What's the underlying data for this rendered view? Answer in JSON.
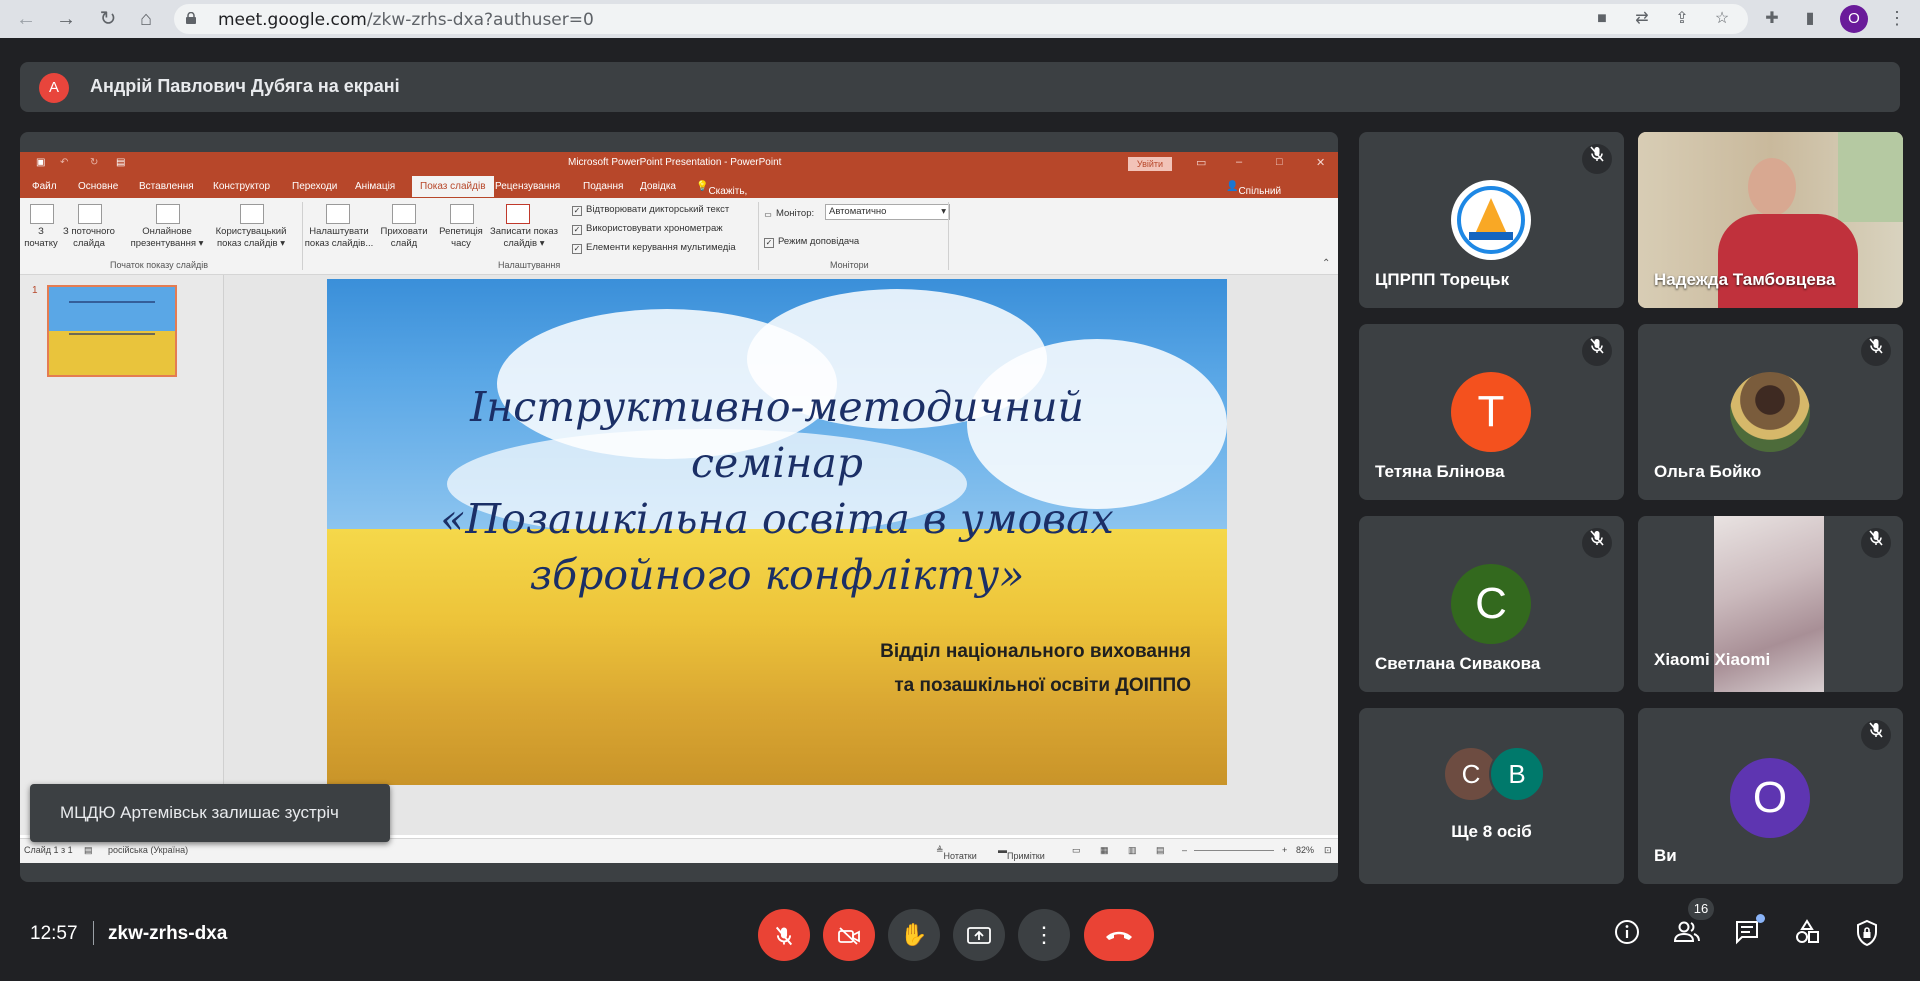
{
  "browser": {
    "url_host": "meet.google.com",
    "url_path": "/zkw-zrhs-dxa?authuser=0",
    "profile_initial": "O"
  },
  "banner": {
    "avatar_initial": "А",
    "text": "Андрій Павлович Дубяга на екрані"
  },
  "ppt": {
    "window_title": "Microsoft PowerPoint Presentation  -  PowerPoint",
    "login_label": "Увійти",
    "tabs": [
      "Файл",
      "Основне",
      "Вставлення",
      "Конструктор",
      "Переходи",
      "Анімація",
      "Показ слайдів",
      "Рецензування",
      "Подання",
      "Довідка"
    ],
    "tell_me": "Скажіть, що потрібно зробити",
    "share": "Спільний доступ",
    "ribbon": {
      "from_start": "З\nпочатку",
      "from_current": "З поточного\nслайда",
      "online": "Онлайнове\nпрезентування ▾",
      "custom": "Користувацький\nпоказ слайдів ▾",
      "group1": "Початок показу слайдів",
      "setup": "Налаштувати\nпоказ слайдів...",
      "hide": "Приховати\nслайд",
      "rehearse": "Репетиція\nчасу",
      "record": "Записати показ\nслайдів ▾",
      "chk_narration": "Відтворювати дикторський текст",
      "chk_timings": "Використовувати хронометраж",
      "chk_media": "Елементи керування мультимедіа",
      "group2": "Налаштування",
      "monitor_label": "Монітор:",
      "monitor_value": "Автоматично",
      "presenter_view": "Режим доповідача",
      "group3": "Монітори"
    },
    "slide_number": "1",
    "slide": {
      "title_line1": "Інструктивно-методичний",
      "title_line2": "семінар",
      "title_line3": "«Позашкільна освіта в умовах",
      "title_line4": "збройного конфлікту»",
      "sub_line1": "Відділ національного виховання",
      "sub_line2": "та позашкільної освіти ДОІППО"
    },
    "status": {
      "slide_count": "Слайд 1 з 1",
      "language": "російська (Україна)",
      "notes": "Нотатки",
      "comments": "Примітки",
      "zoom": "82%"
    }
  },
  "toast": "МЦДЮ Артемівськ залишає зустріч",
  "participants": [
    {
      "name": "ЦПРПП Торецьк",
      "muted": true
    },
    {
      "name": "Надежда Тамбовцева",
      "muted": false
    },
    {
      "name": "Тетяна Блінова",
      "initial": "Т",
      "color": "#f4511e",
      "muted": true
    },
    {
      "name": "Ольга Бойко",
      "muted": true
    },
    {
      "name": "Светлана Сивакова",
      "initial": "С",
      "color": "#33691e",
      "muted": true
    },
    {
      "name": "Xiaomi Xiaomi",
      "muted": true
    },
    {
      "name": "Ще 8 осіб",
      "initials": [
        "С",
        "В"
      ],
      "colors": [
        "#6d4c41",
        "#00796b"
      ]
    },
    {
      "name": "Ви",
      "initial": "О",
      "color": "#5e35b1",
      "muted": true
    }
  ],
  "bottom": {
    "time": "12:57",
    "meeting_code": "zkw-zrhs-dxa",
    "participants_count": "16"
  }
}
